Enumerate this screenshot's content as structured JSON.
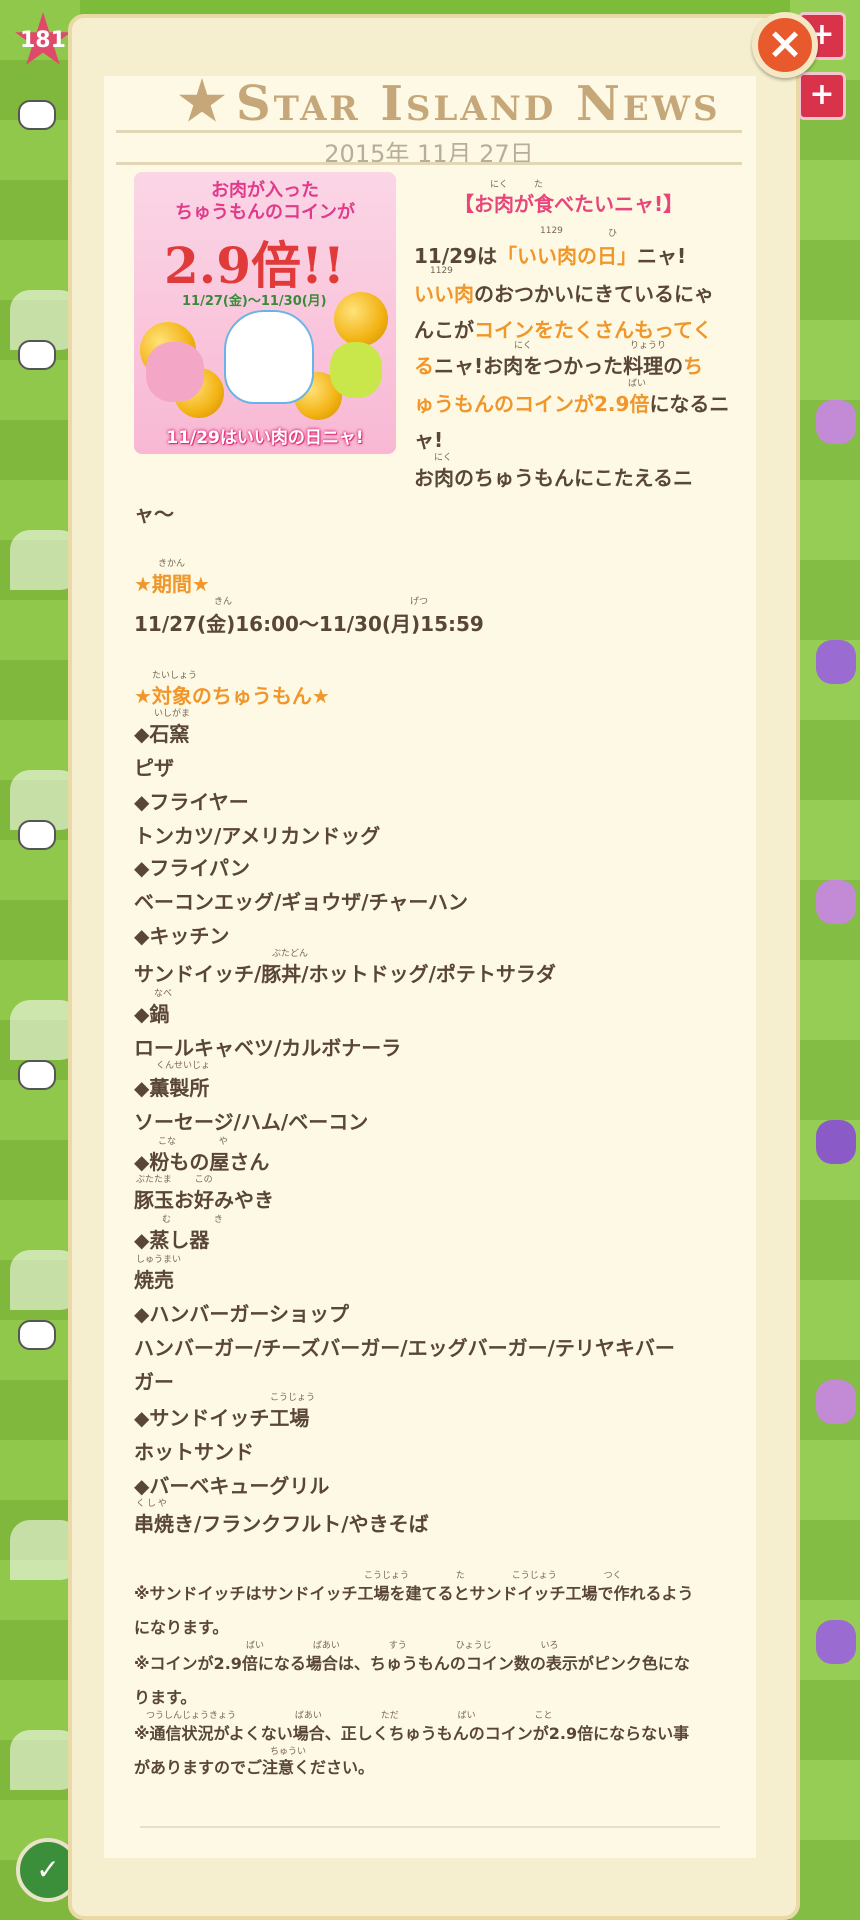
{
  "hud": {
    "level": "181"
  },
  "news": {
    "title": "Star Island News",
    "date": "2015年 11月 27日",
    "close_label": "×"
  },
  "banner": {
    "top_line1": "お肉が入った",
    "top_line2": "ちゅうもんのコインが",
    "multiplier": "2.9倍!!",
    "dates": "11/27(金)〜11/30(月)",
    "footer": "11/29はいい肉の日ニャ!"
  },
  "article": {
    "headline": "【お肉が食べたいニャ!】",
    "headline_ruby": [
      "にく",
      "た"
    ],
    "p1": [
      {
        "text": "11/29",
        "c": ""
      },
      {
        "text": "は",
        "c": ""
      },
      {
        "text": "「いい肉の日」",
        "c": "o"
      },
      {
        "text": "ニャ!",
        "c": ""
      }
    ],
    "p1_ruby": [
      "1129",
      "ひ"
    ],
    "p2": [
      {
        "text": "いい肉",
        "c": "o"
      },
      {
        "text": "のおつかいにきているにゃ",
        "c": ""
      }
    ],
    "p2_ruby": "1129",
    "p3": [
      {
        "text": "んこが",
        "c": ""
      },
      {
        "text": "コインをたくさんもってく",
        "c": "o"
      }
    ],
    "p4": [
      {
        "text": "る",
        "c": "o"
      },
      {
        "text": "ニャ!お肉をつかった料理の",
        "c": ""
      },
      {
        "text": "ち",
        "c": "o"
      }
    ],
    "p4_ruby": [
      "にく",
      "りょうり"
    ],
    "p5": [
      {
        "text": "ゅうもんのコインが2.9倍",
        "c": "o"
      },
      {
        "text": "になるニ",
        "c": ""
      }
    ],
    "p5_ruby": "ばい",
    "p6": "ャ!",
    "p7": "お肉のちゅうもんにこたえるニ",
    "p7_ruby": "にく",
    "p8": "ャ〜",
    "period_heading": "★期間★",
    "period_ruby": "きかん",
    "period_value": "11/27(金)16:00〜11/30(月)15:59",
    "period_value_ruby": [
      "きん",
      "げつ"
    ],
    "target_heading": "★対象のちゅうもん★",
    "target_ruby": "たいしょう",
    "targets": [
      {
        "shop": "◆石窯",
        "ruby": "いしがま",
        "items": "ピザ",
        "items_ruby": ""
      },
      {
        "shop": "◆フライヤー",
        "ruby": "",
        "items": "トンカツ/アメリカンドッグ",
        "items_ruby": ""
      },
      {
        "shop": "◆フライパン",
        "ruby": "",
        "items": "ベーコンエッグ/ギョウザ/チャーハン",
        "items_ruby": ""
      },
      {
        "shop": "◆キッチン",
        "ruby": "",
        "items": "サンドイッチ/豚丼/ホットドッグ/ポテトサラダ",
        "items_ruby": "ぶたどん"
      },
      {
        "shop": "◆鍋",
        "ruby": "なべ",
        "items": "ロールキャベツ/カルボナーラ",
        "items_ruby": ""
      },
      {
        "shop": "◆薫製所",
        "ruby": "くんせいじょ",
        "items": "ソーセージ/ハム/ベーコン",
        "items_ruby": ""
      },
      {
        "shop": "◆粉もの屋さん",
        "ruby": "こな や",
        "items": "豚玉お好みやき",
        "items_ruby": "ぶたたま この"
      },
      {
        "shop": "◆蒸し器",
        "ruby": "む き",
        "items": "焼売",
        "items_ruby": "しゅうまい"
      },
      {
        "shop": "◆ハンバーガーショップ",
        "ruby": "",
        "items": "ハンバーガー/チーズバーガー/エッグバーガー/テリヤキバー",
        "items_ruby": "",
        "items2": "ガー"
      },
      {
        "shop": "◆サンドイッチ工場",
        "ruby": "こうじょう",
        "items": "ホットサンド",
        "items_ruby": ""
      },
      {
        "shop": "◆バーベキューグリル",
        "ruby": "",
        "items": "串焼き/フランクフルト/やきそば",
        "items_ruby": "くしや"
      }
    ],
    "notes": [
      {
        "l1": "※サンドイッチはサンドイッチ工場を建てるとサンドイッチ工場で作れるよう",
        "l2": "になります。",
        "ruby": "こうじょう た こうじょう つく"
      },
      {
        "l1": "※コインが2.9倍になる場合は、ちゅうもんのコイン数の表示がピンク色にな",
        "l2": "ります。",
        "ruby": "ばい ばあい すう ひょうじ いろ"
      },
      {
        "l1": "※通信状況がよくない場合、正しくちゅうもんのコインが2.9倍にならない事",
        "l2": "がありますのでご注意ください。",
        "ruby": "つうしんじょうきょう ばあい ただ ばい こと"
      }
    ],
    "notes_ruby_l2": "ちゅうい"
  },
  "colors": {
    "accent": "#f0962a",
    "headline": "#e8467a",
    "body": "#5a4636",
    "panel": "#fdf9e4"
  }
}
